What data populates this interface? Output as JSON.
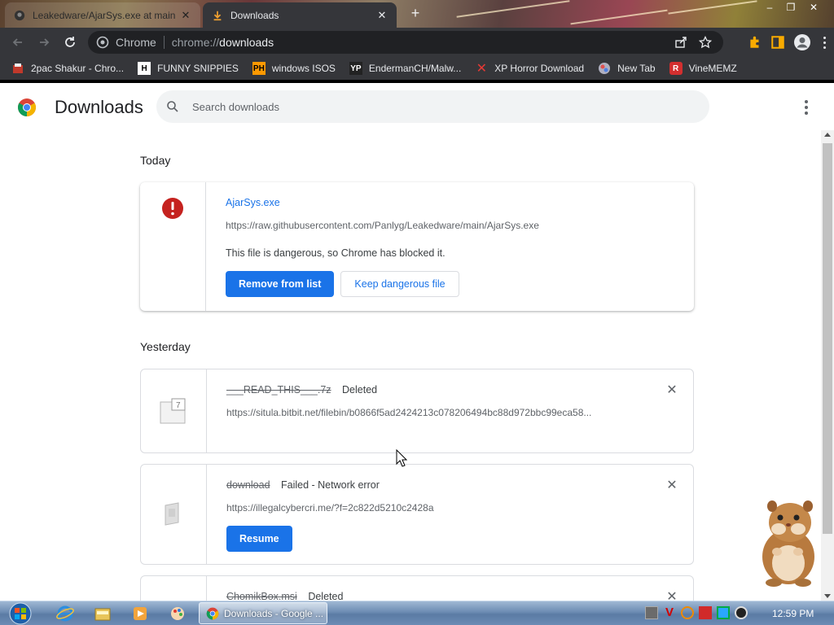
{
  "tabs": [
    {
      "title": "Leakedware/AjarSys.exe at main",
      "close": "✕",
      "active": false
    },
    {
      "title": "Downloads",
      "close": "✕",
      "active": true
    }
  ],
  "newtab_glyph": "+",
  "window_controls": {
    "minimize": "–",
    "maximize": "❐",
    "close": "✕"
  },
  "toolbar": {
    "site_chip": "Chrome",
    "url_scheme": "chrome://",
    "url_host": "downloads"
  },
  "bookmarks": [
    {
      "label": "2pac Shakur - Chro...",
      "icon": "tupac-icon"
    },
    {
      "label": "FUNNY SNIPPIES",
      "icon": "h-icon"
    },
    {
      "label": "windows ISOS",
      "icon": "ph-icon"
    },
    {
      "label": "EndermanCH/Malw...",
      "icon": "yp-icon"
    },
    {
      "label": "XP Horror Download",
      "icon": "x-icon"
    },
    {
      "label": "New Tab",
      "icon": "globe-icon"
    },
    {
      "label": "VineMEMZ",
      "icon": "r-icon"
    }
  ],
  "page": {
    "title": "Downloads",
    "search_placeholder": "Search downloads"
  },
  "sections": {
    "today": "Today",
    "yesterday": "Yesterday"
  },
  "downloads": [
    {
      "filename": "AjarSys.exe",
      "url": "https://raw.githubusercontent.com/Panlyg/Leakedware/main/AjarSys.exe",
      "message": "This file is dangerous, so Chrome has blocked it.",
      "buttons": {
        "remove": "Remove from list",
        "keep": "Keep dangerous file"
      }
    },
    {
      "filename": "___READ_THIS___.7z",
      "status": "Deleted",
      "url": "https://situla.bitbit.net/filebin/b0866f5ad2424213c078206494bc88d972bbc99eca58..."
    },
    {
      "filename": "download",
      "status": "Failed - Network error",
      "url": "https://illegalcybercri.me/?f=2c822d5210c2428a",
      "buttons": {
        "resume": "Resume"
      }
    },
    {
      "filename": "ChomikBox.msi",
      "status": "Deleted"
    }
  ],
  "remove_glyph": "✕",
  "taskbar": {
    "active_task": "Downloads - Google ...",
    "clock": "12:59 PM"
  },
  "colors": {
    "accent": "#1a73e8",
    "danger": "#c5221f",
    "frame": "#35363a"
  }
}
